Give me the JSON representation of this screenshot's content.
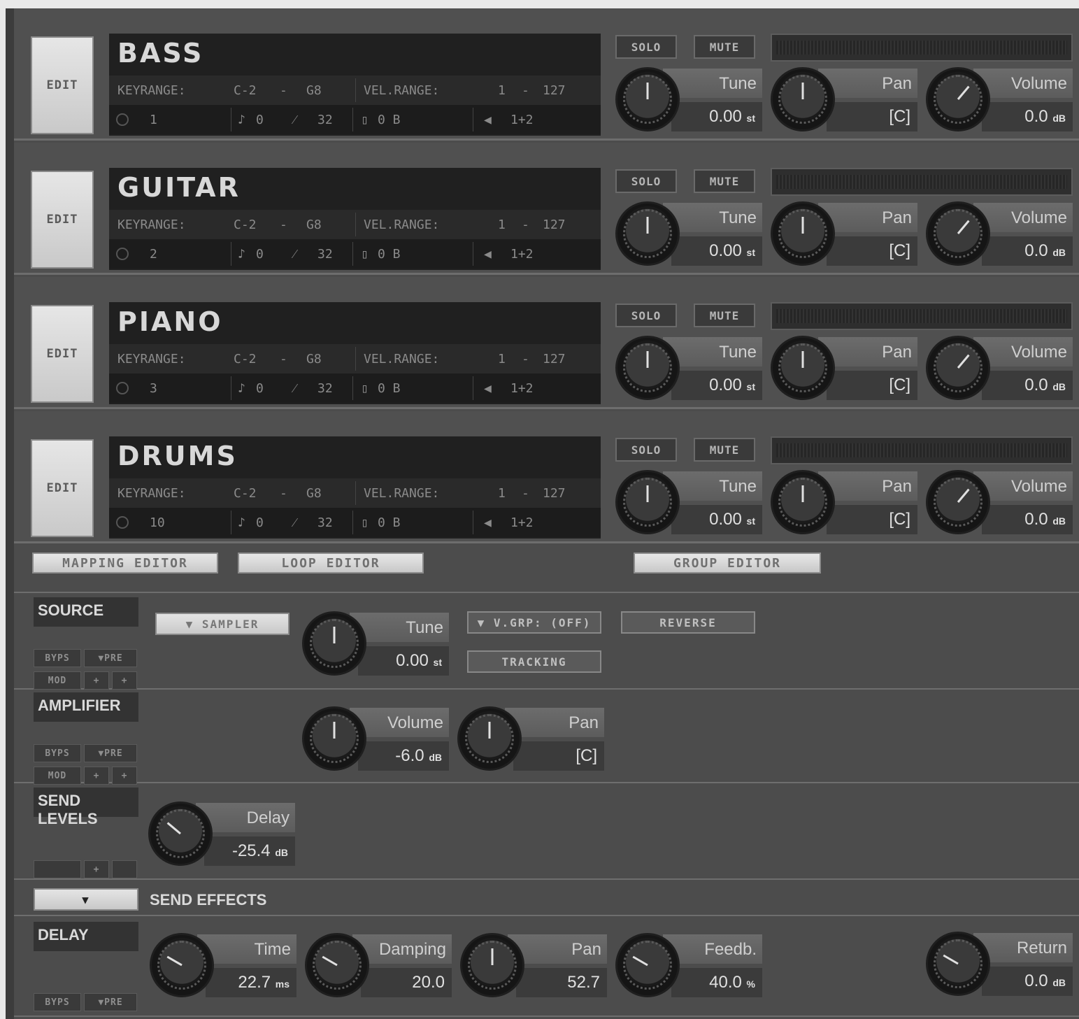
{
  "instruments": [
    {
      "name": "BASS",
      "edit": "EDIT",
      "keyrange_label": "KEYRANGE:",
      "key_lo": "C-2",
      "dash": "-",
      "key_hi": "G8",
      "vel_label": "VEL.RANGE:",
      "vel_lo": "1",
      "vel_hi": "127",
      "midi": "1",
      "transpose": "0",
      "bend": "32",
      "out": "0 B",
      "channels": "1+2",
      "solo": "SOLO",
      "mute": "MUTE",
      "tune_label": "Tune",
      "tune_value": "0.00",
      "tune_unit": "st",
      "pan_label": "Pan",
      "pan_value": "[C]",
      "vol_label": "Volume",
      "vol_value": "0.0",
      "vol_unit": "dB"
    },
    {
      "name": "GUITAR",
      "edit": "EDIT",
      "keyrange_label": "KEYRANGE:",
      "key_lo": "C-2",
      "dash": "-",
      "key_hi": "G8",
      "vel_label": "VEL.RANGE:",
      "vel_lo": "1",
      "vel_hi": "127",
      "midi": "2",
      "transpose": "0",
      "bend": "32",
      "out": "0 B",
      "channels": "1+2",
      "solo": "SOLO",
      "mute": "MUTE",
      "tune_label": "Tune",
      "tune_value": "0.00",
      "tune_unit": "st",
      "pan_label": "Pan",
      "pan_value": "[C]",
      "vol_label": "Volume",
      "vol_value": "0.0",
      "vol_unit": "dB"
    },
    {
      "name": "PIANO",
      "edit": "EDIT",
      "keyrange_label": "KEYRANGE:",
      "key_lo": "C-2",
      "dash": "-",
      "key_hi": "G8",
      "vel_label": "VEL.RANGE:",
      "vel_lo": "1",
      "vel_hi": "127",
      "midi": "3",
      "transpose": "0",
      "bend": "32",
      "out": "0 B",
      "channels": "1+2",
      "solo": "SOLO",
      "mute": "MUTE",
      "tune_label": "Tune",
      "tune_value": "0.00",
      "tune_unit": "st",
      "pan_label": "Pan",
      "pan_value": "[C]",
      "vol_label": "Volume",
      "vol_value": "0.0",
      "vol_unit": "dB"
    },
    {
      "name": "DRUMS",
      "edit": "EDIT",
      "keyrange_label": "KEYRANGE:",
      "key_lo": "C-2",
      "dash": "-",
      "key_hi": "G8",
      "vel_label": "VEL.RANGE:",
      "vel_lo": "1",
      "vel_hi": "127",
      "midi": "10",
      "transpose": "0",
      "bend": "32",
      "out": "0 B",
      "channels": "1+2",
      "solo": "SOLO",
      "mute": "MUTE",
      "tune_label": "Tune",
      "tune_value": "0.00",
      "tune_unit": "st",
      "pan_label": "Pan",
      "pan_value": "[C]",
      "vol_label": "Volume",
      "vol_value": "0.0",
      "vol_unit": "dB"
    }
  ],
  "editor_tabs": {
    "mapping": "MAPPING EDITOR",
    "loop": "LOOP EDITOR",
    "group": "GROUP EDITOR"
  },
  "source": {
    "title": "SOURCE",
    "sampler": "▼ SAMPLER",
    "tune_label": "Tune",
    "tune_value": "0.00",
    "tune_unit": "st",
    "vgrp": "▼ V.GRP: (OFF)",
    "reverse": "REVERSE",
    "tracking": "TRACKING",
    "byps": "BYPS",
    "pre": "▼PRE",
    "mod": "MOD",
    "plus": "+"
  },
  "amplifier": {
    "title": "AMPLIFIER",
    "vol_label": "Volume",
    "vol_value": "-6.0",
    "vol_unit": "dB",
    "pan_label": "Pan",
    "pan_value": "[C]",
    "byps": "BYPS",
    "pre": "▼PRE",
    "mod": "MOD",
    "plus": "+"
  },
  "send_levels": {
    "title": "SEND LEVELS",
    "delay_label": "Delay",
    "delay_value": "-25.4",
    "delay_unit": "dB",
    "plus": "+"
  },
  "send_effects": {
    "title": "SEND EFFECTS",
    "dropdown": "▼"
  },
  "delay": {
    "title": "DELAY",
    "time_label": "Time",
    "time_value": "22.7",
    "time_unit": "ms",
    "damping_label": "Damping",
    "damping_value": "20.0",
    "pan_label": "Pan",
    "pan_value": "52.7",
    "feedb_label": "Feedb.",
    "feedb_value": "40.0",
    "feedb_unit": "%",
    "return_label": "Return",
    "return_value": "0.0",
    "return_unit": "dB",
    "byps": "BYPS",
    "pre": "▼PRE"
  },
  "colors": {
    "panel": "#4c4c4c",
    "name_panel": "#202020",
    "text_light": "#d8d8d8"
  },
  "icons": [
    "midi-channel-icon",
    "transpose-icon",
    "pitch-bend-icon",
    "output-icon",
    "speaker-icon",
    "knob-icon"
  ]
}
